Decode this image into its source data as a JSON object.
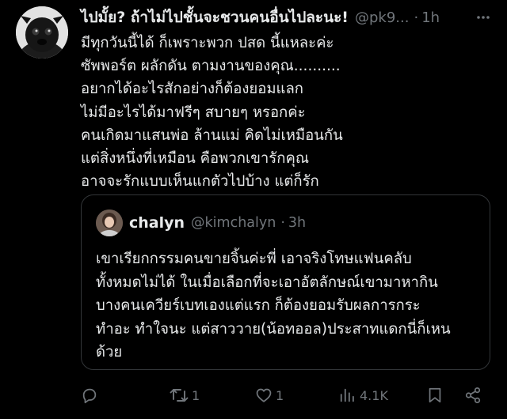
{
  "tweet": {
    "author_name": "ไปมั้ย? ถ้าไม่ไปชั้นจะชวนคนอื่นไปละนะ!",
    "author_handle": "@pk9...",
    "separator": "·",
    "time": "1h",
    "body_lines": [
      "มีทุกวันนี้ได้ ก็เพราะพวก ปสด นี้แหละค่ะ",
      "ซัพพอร์ต ผลักดัน ตามงานของคุณ..........",
      "อยากได้อะไรสักอย่างก็ต้องยอมแลก",
      "ไม่มีอะไรได้มาฟรีๆ สบายๆ หรอกค่ะ",
      "คนเกิดมาแสนพ่อ ล้านแม่ คิดไม่เหมือนกัน",
      "แต่สิ่งหนึ่งที่เหมือน คือพวกเขารักคุณ",
      "อาจจะรักแบบเห็นแกตัวไปบ้าง แต่ก็รัก"
    ]
  },
  "quote": {
    "author_name": "chalyn",
    "author_handle": "@kimchalyn",
    "separator": "·",
    "time": "3h",
    "body_lines": [
      "เขาเรียกกรรมคนขายจิ้นค่ะพี่ เอาจริงโทษแฟนคลับ",
      "ทั้งหมดไม่ได้ ในเมื่อเลือกที่จะเอาอัตลักษณ์เขามาหากิน",
      "บางคนเควียร์เบทเองแต่แรก ก็ต้องยอมรับผลการกระ",
      "ทำอะ ทำใจนะ แต่สาววาย(น้อทออล)ประสาทแดกนี่ก็เหน",
      "ด้วย"
    ]
  },
  "actions": {
    "replies": "",
    "retweets": "1",
    "likes": "1",
    "views": "4.1K"
  },
  "icons": {
    "avatar": "pug-dog-avatar",
    "more": "more-icon",
    "reply": "reply-icon",
    "retweet": "retweet-icon",
    "like": "heart-icon",
    "views": "views-icon",
    "bookmark": "bookmark-icon",
    "share": "share-icon"
  },
  "colors": {
    "background": "#000000",
    "text": "#e7e9ea",
    "secondary": "#71767b",
    "border": "#333639"
  }
}
